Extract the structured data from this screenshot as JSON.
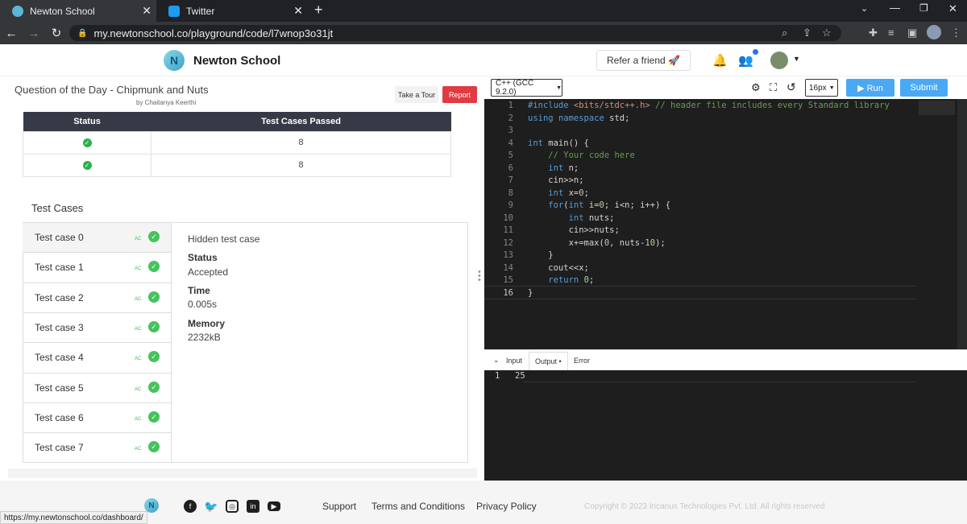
{
  "browser": {
    "tabs": [
      {
        "label": "Newton School",
        "active": true,
        "color": "#5bb7d8"
      },
      {
        "label": "Twitter",
        "active": false,
        "color": "#1d9bf0"
      }
    ],
    "url": "my.newtonschool.co/playground/code/l7wnop3o31jt",
    "status_url": "https://my.newtonschool.co/dashboard/"
  },
  "header": {
    "brand": "Newton School",
    "refer_label": "Refer a friend 🚀"
  },
  "question": {
    "title": "Question of the Day - Chipmunk and Nuts",
    "author": "by Chaitanya Keerthi",
    "tour_label": "Take a Tour",
    "report_label": "Report"
  },
  "status_table": {
    "headers": [
      "Status",
      "Test Cases Passed"
    ],
    "rows": [
      {
        "passed": "8"
      },
      {
        "passed": "8"
      }
    ]
  },
  "test_cases": {
    "heading": "Test Cases",
    "items": [
      "Test case 0",
      "Test case 1",
      "Test case 2",
      "Test case 3",
      "Test case 4",
      "Test case 5",
      "Test case 6",
      "Test case 7"
    ],
    "verdict": "AC",
    "detail": {
      "title": "Hidden test case",
      "status_label": "Status",
      "status_value": "Accepted",
      "time_label": "Time",
      "time_value": "0.005s",
      "memory_label": "Memory",
      "memory_value": "2232kB"
    }
  },
  "editor": {
    "language": "C++ (GCC 9.2.0)",
    "font_size": "16px",
    "run_label": "▶ Run",
    "submit_label": "Submit",
    "code_lines": [
      "#include <bits/stdc++.h> // header file includes every Standard library",
      "using namespace std;",
      "",
      "int main() {",
      "    // Your code here",
      "    int n;",
      "    cin>>n;",
      "    int x=0;",
      "    for(int i=0; i<n; i++) {",
      "        int nuts;",
      "        cin>>nuts;",
      "        x+=max(0, nuts-10);",
      "    }",
      "    cout<<x;",
      "    return 0;",
      "}"
    ]
  },
  "io": {
    "tabs": [
      "Input",
      "Output •",
      "Error"
    ],
    "output_line_no": "1",
    "output_value": "25"
  },
  "footer": {
    "links": [
      "Support",
      "Terms and Conditions",
      "Privacy Policy"
    ],
    "copyright": "Copyright © 2023 Incanus Technologies Pvt. Ltd. All rights reserved"
  }
}
